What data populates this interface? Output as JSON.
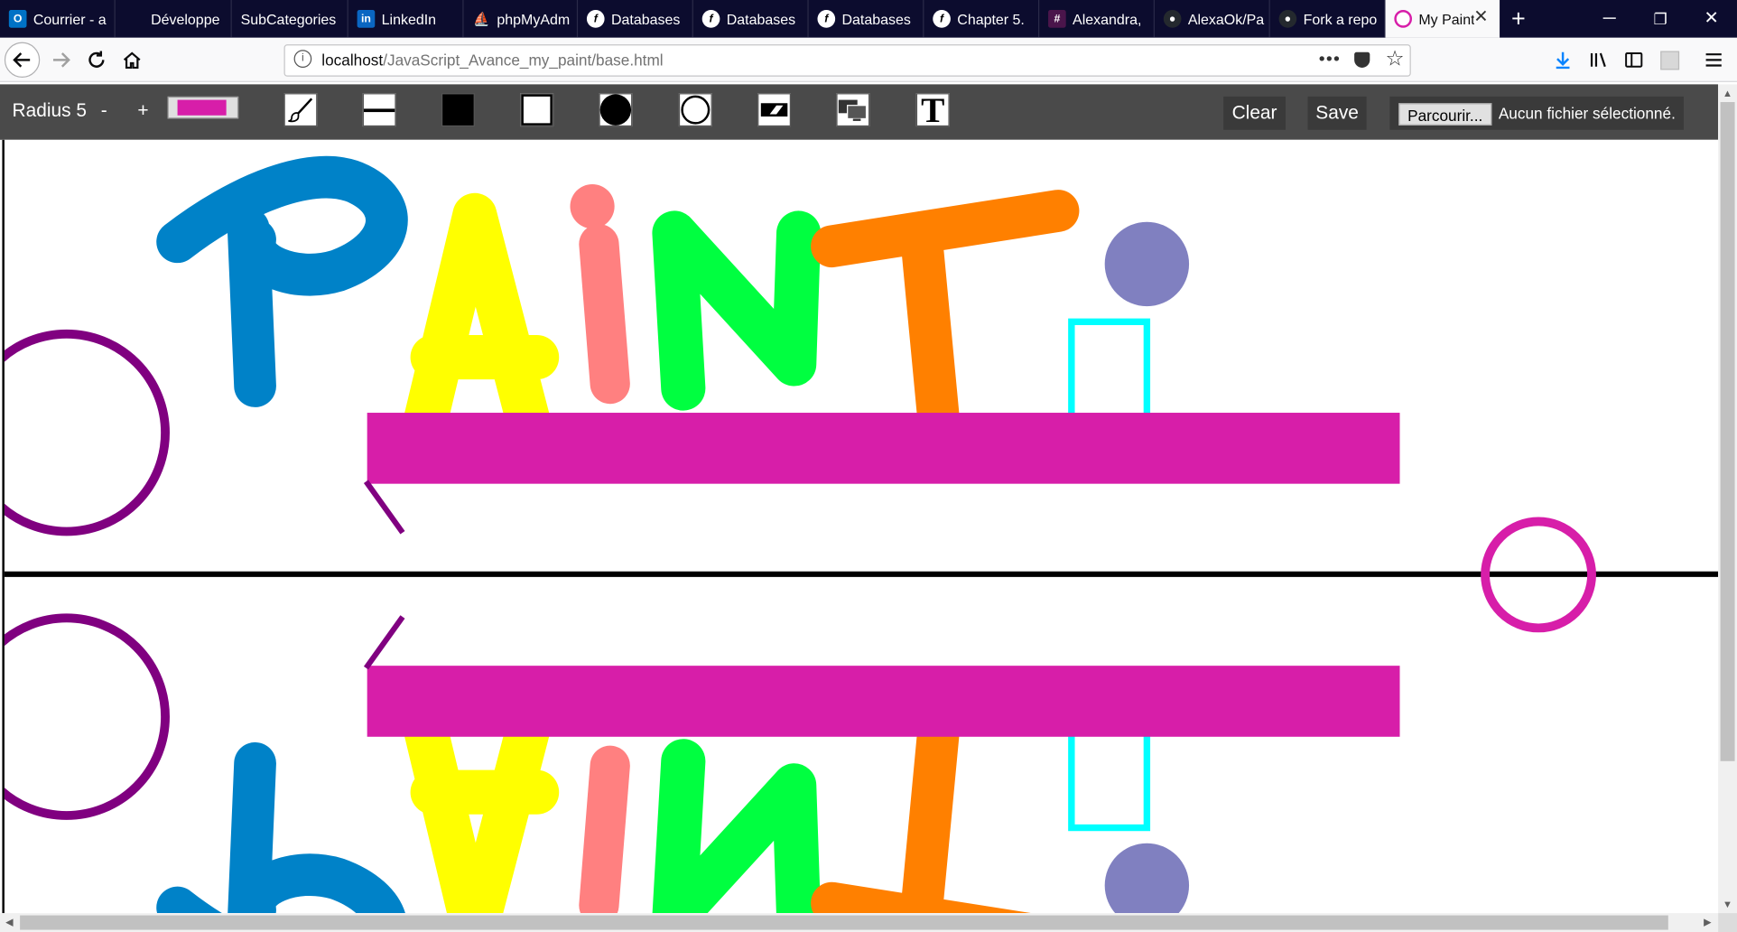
{
  "browser": {
    "tabs": [
      {
        "label": "Courrier - a",
        "icon": "outlook-icon",
        "color": "#0072c6"
      },
      {
        "label": "Développe",
        "icon": "page-icon",
        "color": "#1b1b2e"
      },
      {
        "label": "SubCategories",
        "icon": "page-icon",
        "color": "#1b1b2e"
      },
      {
        "label": "LinkedIn",
        "icon": "linkedin-icon",
        "color": "#0a66c2"
      },
      {
        "label": "phpMyAdm",
        "icon": "phpmyadmin-icon",
        "color": "#f29111"
      },
      {
        "label": "Databases",
        "icon": "symfony-icon",
        "color": "#000000"
      },
      {
        "label": "Databases",
        "icon": "symfony-icon",
        "color": "#000000"
      },
      {
        "label": "Databases",
        "icon": "symfony-icon",
        "color": "#000000"
      },
      {
        "label": "Chapter 5.",
        "icon": "symfony-icon",
        "color": "#000000"
      },
      {
        "label": "Alexandra,",
        "icon": "slack-icon",
        "color": "#4a154b"
      },
      {
        "label": "AlexaOk/Pa",
        "icon": "github-icon",
        "color": "#24292e"
      },
      {
        "label": "Fork a repo",
        "icon": "github-icon",
        "color": "#24292e"
      },
      {
        "label": "My Paint",
        "icon": "mypaint-icon",
        "color": "#d71ea9",
        "active": true
      }
    ],
    "url_host": "localhost",
    "url_path": "/JavaScript_Avance_my_paint/base.html"
  },
  "toolbar": {
    "radius_label": "Radius 5",
    "minus_label": "-",
    "plus_label": "+",
    "current_color": "#d71ea9",
    "tools": [
      {
        "name": "brush-tool",
        "icon": "brush-icon"
      },
      {
        "name": "line-tool",
        "icon": "line-icon"
      },
      {
        "name": "filled-rectangle-tool",
        "icon": "filled-square-icon"
      },
      {
        "name": "empty-rectangle-tool",
        "icon": "empty-square-icon"
      },
      {
        "name": "filled-circle-tool",
        "icon": "filled-circle-icon"
      },
      {
        "name": "empty-circle-tool",
        "icon": "empty-circle-icon"
      },
      {
        "name": "eraser-tool",
        "icon": "eraser-icon"
      },
      {
        "name": "mirror-tool",
        "icon": "monitors-icon"
      },
      {
        "name": "text-tool",
        "icon": "text-t-icon"
      }
    ],
    "text_tool_glyph": "T",
    "clear_label": "Clear",
    "save_label": "Save",
    "browse_label": "Parcourir...",
    "no_file_label": "Aucun fichier sélectionné."
  },
  "drawing": {
    "colors": {
      "blue": "#0082c8",
      "yellow": "#ffff00",
      "salmon": "#ff8080",
      "green": "#00ff40",
      "orange": "#ff8000",
      "violet": "#8080c0",
      "cyan": "#00ffff",
      "magenta": "#d71ea9",
      "purple": "#800080",
      "black": "#000000"
    }
  }
}
